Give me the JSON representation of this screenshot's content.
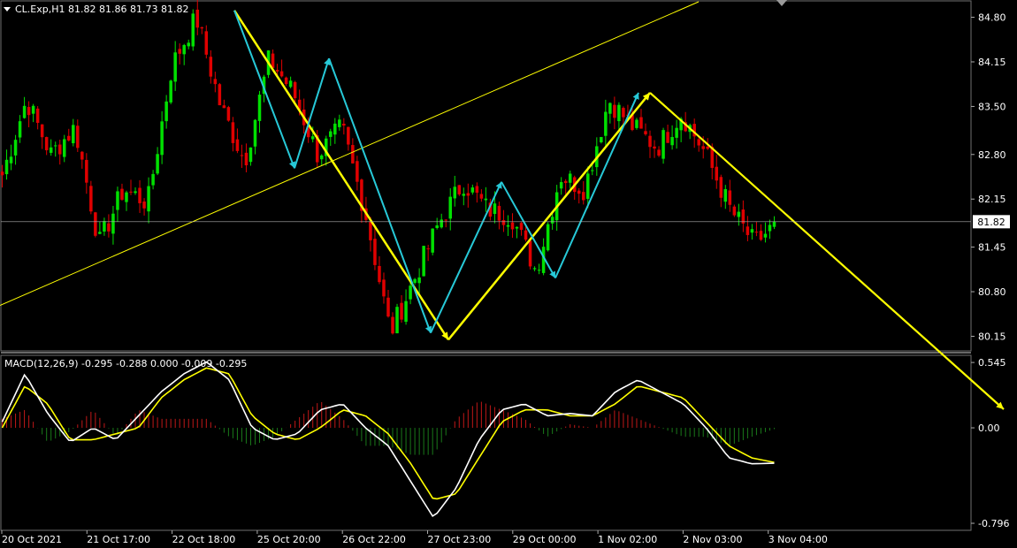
{
  "header": {
    "symbol_line": "CL.Exp,H1  81.82 81.86 81.73 81.82",
    "indicator_line": "MACD(12,26,9) -0.295 -0.288 0.000 -0.009 -0.295"
  },
  "colors": {
    "background": "#000000",
    "bull_candle": "#00e000",
    "bear_candle": "#e00000",
    "macd_line": "#ffffff",
    "signal_line": "#ffff00",
    "hist_pos": "#c01818",
    "hist_neg": "#1a7a1a",
    "zigzag": "#27c9d8",
    "trend_arrow": "#ffff00"
  },
  "chart_data": [
    {
      "type": "candlestick",
      "symbol": "CL.Exp",
      "timeframe": "H1",
      "last_price": "81.82",
      "ylim": [
        79.95,
        85.0
      ],
      "price_ticks": [
        "84.80",
        "84.15",
        "83.50",
        "82.80",
        "82.15",
        "81.45",
        "80.80",
        "80.15"
      ],
      "x_ticks": [
        "20 Oct 2021",
        "21 Oct 17:00",
        "22 Oct 18:00",
        "25 Oct 20:00",
        "26 Oct 22:00",
        "27 Oct 23:00",
        "29 Oct 00:00",
        "1 Nov 02:00",
        "2 Nov 03:00",
        "3 Nov 04:00"
      ],
      "key_prices": [
        82.5,
        83.6,
        82.8,
        83.2,
        81.5,
        82.3,
        82.1,
        84.1,
        84.8,
        83.5,
        82.7,
        84.2,
        83.7,
        82.8,
        83.2,
        81.9,
        80.2,
        81.0,
        81.8,
        82.4,
        82.0,
        81.9,
        81.1,
        82.5,
        82.3,
        83.6,
        83.2,
        82.9,
        83.4,
        82.8,
        82.0,
        81.5,
        81.82
      ],
      "zigzag_prices": [
        84.9,
        82.6,
        84.2,
        80.2,
        82.4,
        81.0,
        83.7
      ],
      "trend_lines": [
        {
          "from_price": 80.6,
          "to_price": 85.0,
          "style": "thin"
        },
        {
          "from_price": 84.9,
          "to_price": 80.1,
          "style": "thick"
        },
        {
          "from_price": 80.1,
          "to_price": 83.7,
          "style": "thick"
        },
        {
          "from_price": 83.7,
          "to_price": 81.8,
          "style": "thin"
        }
      ]
    },
    {
      "type": "line",
      "name": "MACD(12,26,9)",
      "ylim": [
        -0.84,
        0.59
      ],
      "y_ticks": [
        "0.545",
        "0.00",
        "-0.796"
      ],
      "macd": [
        0.05,
        0.45,
        0.12,
        -0.12,
        0.0,
        -0.1,
        0.1,
        0.3,
        0.45,
        0.55,
        0.4,
        0.0,
        -0.1,
        -0.05,
        0.15,
        0.2,
        0.0,
        -0.15,
        -0.45,
        -0.75,
        -0.5,
        -0.1,
        0.15,
        0.2,
        0.1,
        0.12,
        0.1,
        0.3,
        0.4,
        0.3,
        0.2,
        0.0,
        -0.25,
        -0.3,
        -0.295
      ],
      "signal": [
        0.0,
        0.35,
        0.2,
        -0.1,
        -0.1,
        -0.05,
        0.0,
        0.25,
        0.4,
        0.5,
        0.45,
        0.1,
        -0.05,
        -0.1,
        0.0,
        0.15,
        0.1,
        -0.05,
        -0.3,
        -0.6,
        -0.55,
        -0.25,
        0.05,
        0.15,
        0.15,
        0.1,
        0.1,
        0.2,
        0.35,
        0.3,
        0.25,
        0.05,
        -0.15,
        -0.25,
        -0.288
      ]
    }
  ]
}
